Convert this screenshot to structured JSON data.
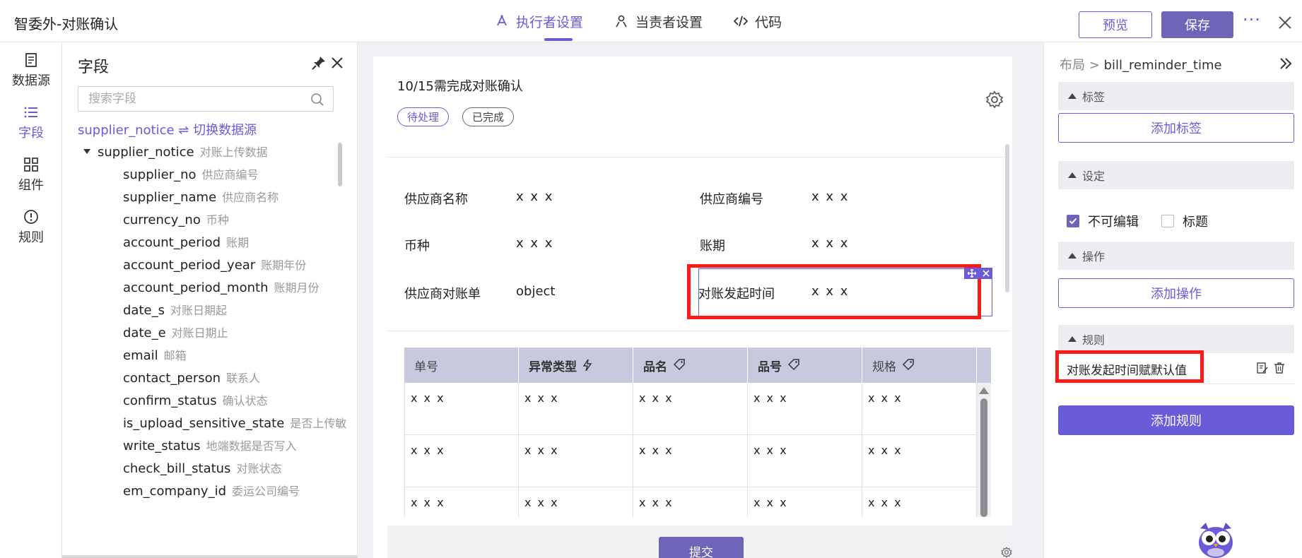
{
  "app": {
    "title": "智委外-对账确认",
    "tabs": [
      {
        "label": "执行者设置",
        "active": true
      },
      {
        "label": "当责者设置",
        "active": false
      },
      {
        "label": "代码",
        "active": false
      }
    ],
    "preview_label": "预览",
    "save_label": "保存",
    "more_label": "···"
  },
  "rail": {
    "items": [
      {
        "label": "数据源",
        "icon": "datasource-icon"
      },
      {
        "label": "字段",
        "icon": "list-icon",
        "active": true
      },
      {
        "label": "组件",
        "icon": "grid-icon"
      },
      {
        "label": "规则",
        "icon": "alert-circle-icon"
      }
    ]
  },
  "fields_panel": {
    "title": "字段",
    "search_placeholder": "搜索字段",
    "switch_source": "supplier_notice ⇌ 切换数据源",
    "root": {
      "name": "supplier_notice",
      "desc": "对账上传数据"
    },
    "items": [
      {
        "name": "supplier_no",
        "desc": "供应商编号"
      },
      {
        "name": "supplier_name",
        "desc": "供应商名称"
      },
      {
        "name": "currency_no",
        "desc": "币种"
      },
      {
        "name": "account_period",
        "desc": "账期"
      },
      {
        "name": "account_period_year",
        "desc": "账期年份"
      },
      {
        "name": "account_period_month",
        "desc": "账期月份"
      },
      {
        "name": "date_s",
        "desc": "对账日期起"
      },
      {
        "name": "date_e",
        "desc": "对账日期止"
      },
      {
        "name": "email",
        "desc": "邮箱"
      },
      {
        "name": "contact_person",
        "desc": "联系人"
      },
      {
        "name": "confirm_status",
        "desc": "确认状态"
      },
      {
        "name": "is_upload_sensitive_state",
        "desc": "是否上传敏"
      },
      {
        "name": "write_status",
        "desc": "地端数据是否写入"
      },
      {
        "name": "check_bill_status",
        "desc": "对账状态"
      },
      {
        "name": "em_company_id",
        "desc": "委运公司编号"
      }
    ]
  },
  "canvas": {
    "card_title": "10/15需完成对账确认",
    "tags": [
      "待处理",
      "已完成"
    ],
    "form": [
      {
        "label": "供应商名称",
        "value": "x x x"
      },
      {
        "label": "供应商编号",
        "value": "x x x"
      },
      {
        "label": "币种",
        "value": "x x x"
      },
      {
        "label": "账期",
        "value": "x x x"
      },
      {
        "label": "供应商对账单",
        "value": "object"
      },
      {
        "label": "对账发起时间",
        "value": "x x x"
      }
    ],
    "table": {
      "columns": [
        "单号",
        "异常类型",
        "品名",
        "品号",
        "规格"
      ],
      "rows": [
        [
          "x x x",
          "x x x",
          "x x x",
          "x x x",
          "x x x"
        ],
        [
          "x x x",
          "x x x",
          "x x x",
          "x x x",
          "x x x"
        ],
        [
          "x x x",
          "x x x",
          "x x x",
          "x x x",
          "x x x"
        ]
      ]
    },
    "submit_label": "提交"
  },
  "props": {
    "crumb_root": "布局",
    "crumb_sep": ">",
    "crumb_current": "bill_reminder_time",
    "sections": {
      "label": "标签",
      "settings": "设定",
      "actions": "操作",
      "rules": "规则"
    },
    "add_label": "添加标签",
    "checkbox_readonly": {
      "label": "不可编辑",
      "checked": true
    },
    "checkbox_title": {
      "label": "标题",
      "checked": false
    },
    "add_action": "添加操作",
    "rule_item": "对账发起时间赋默认值",
    "add_rule": "添加规则"
  },
  "colors": {
    "accent": "#6a5bd8",
    "primary_button": "#6e64b8",
    "highlight": "#ff1a1a",
    "table_header": "#c7cadf"
  }
}
